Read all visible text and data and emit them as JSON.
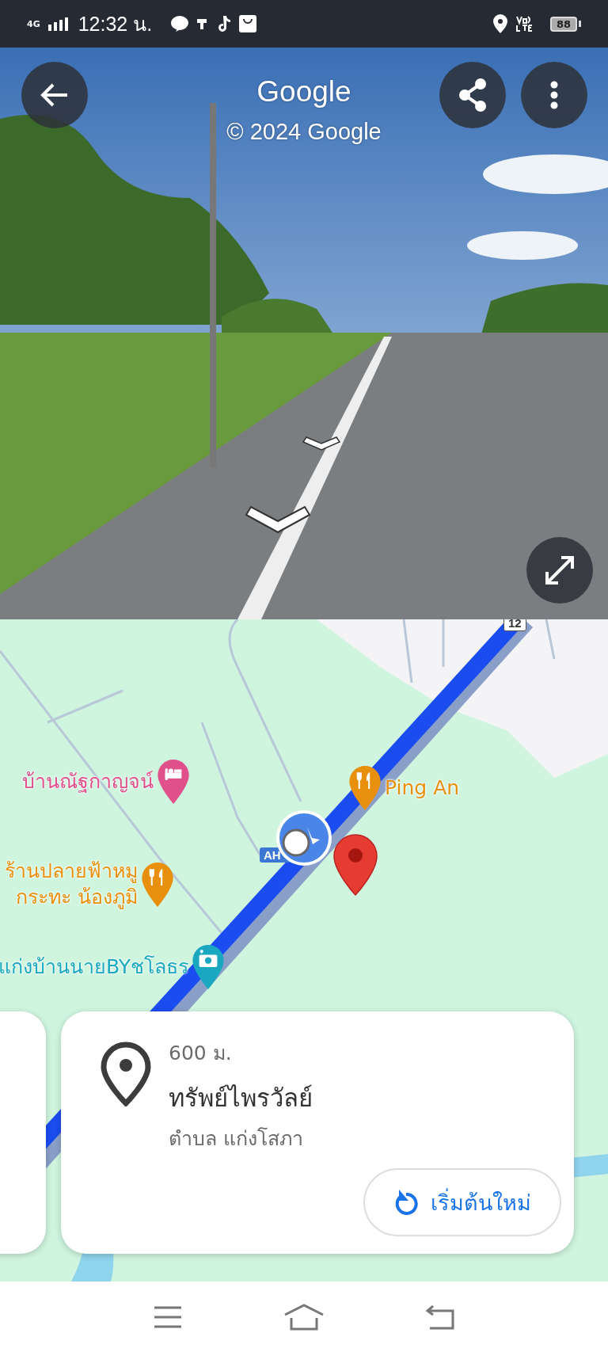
{
  "status_bar": {
    "network": "4G",
    "time": "12:32 น.",
    "battery": "88"
  },
  "street_view": {
    "title": "Google",
    "copyright": "© 2024 Google"
  },
  "map": {
    "shields": [
      "12",
      "AH"
    ],
    "places": [
      {
        "name": "บ้านณัฐกาญจน์",
        "kind": "hotel",
        "color": "#e0508a"
      },
      {
        "name": "Ping An",
        "kind": "restaurant",
        "color": "#e8900c"
      },
      {
        "name": "ร้านปลายฟ้าหมู\nกระทะ น้องภูมิ",
        "kind": "restaurant",
        "color": "#e8900c"
      },
      {
        "name": "แก่งบ้านนายBYชโลธร",
        "kind": "photo",
        "color": "#1aa8c0"
      }
    ]
  },
  "place_card": {
    "distance": "600 ม.",
    "title": "ทรัพย์ไพรวัลย์",
    "subtitle": "ตำบล แก่งโสภา",
    "button": "เริ่มต้นใหม่"
  }
}
